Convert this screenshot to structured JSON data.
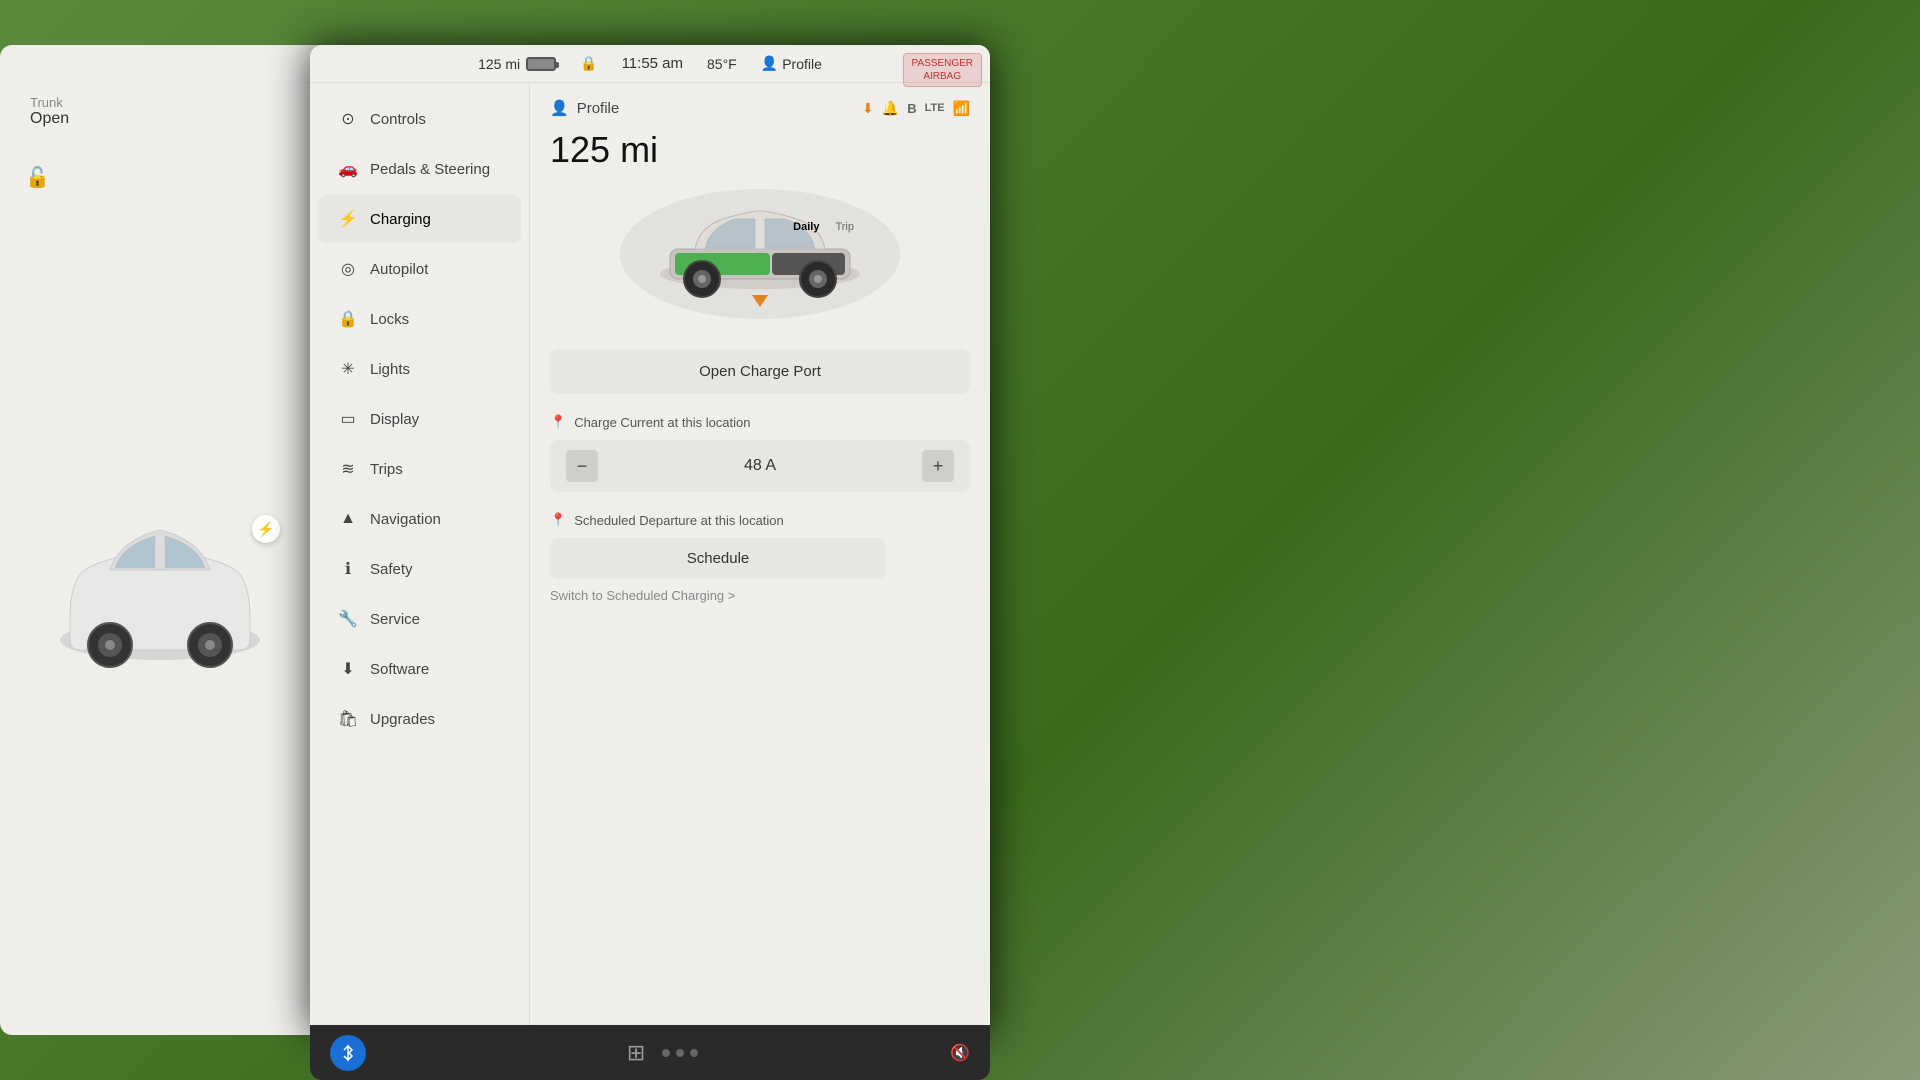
{
  "statusBar": {
    "battery": "125 mi",
    "time": "11:55 am",
    "temperature": "85°F",
    "profile": "Profile"
  },
  "sidebar": {
    "items": [
      {
        "id": "controls",
        "label": "Controls",
        "icon": "⊙"
      },
      {
        "id": "pedals",
        "label": "Pedals & Steering",
        "icon": "🚗"
      },
      {
        "id": "charging",
        "label": "Charging",
        "icon": "⚡",
        "active": true
      },
      {
        "id": "autopilot",
        "label": "Autopilot",
        "icon": "◎"
      },
      {
        "id": "locks",
        "label": "Locks",
        "icon": "🔒"
      },
      {
        "id": "lights",
        "label": "Lights",
        "icon": "✳"
      },
      {
        "id": "display",
        "label": "Display",
        "icon": "▭"
      },
      {
        "id": "trips",
        "label": "Trips",
        "icon": "≋"
      },
      {
        "id": "navigation",
        "label": "Navigation",
        "icon": "▲"
      },
      {
        "id": "safety",
        "label": "Safety",
        "icon": "ℹ"
      },
      {
        "id": "service",
        "label": "Service",
        "icon": "🔧"
      },
      {
        "id": "software",
        "label": "Software",
        "icon": "⬇"
      },
      {
        "id": "upgrades",
        "label": "Upgrades",
        "icon": "🛍"
      }
    ]
  },
  "chargingPanel": {
    "profileLabel": "Profile",
    "batteryMiles": "125 mi",
    "batteryTabs": [
      "Daily",
      "Trip"
    ],
    "openChargePortLabel": "Open Charge Port",
    "chargeCurrentLabel": "Charge Current at this location",
    "currentValue": "48 A",
    "decrementLabel": "−",
    "incrementLabel": "+",
    "scheduledDepartureLabel": "Scheduled Departure at this location",
    "scheduleLabel": "Schedule",
    "switchLink": "Switch to Scheduled Charging >"
  },
  "trunk": {
    "label": "Trunk",
    "status": "Open"
  },
  "taskbar": {
    "bluetoothIcon": "𝔅",
    "gridIcon": "▦",
    "muteIcon": "🔇"
  },
  "airbagBadge": {
    "line1": "PASSENGER",
    "line2": "AIRBAG"
  },
  "statusIcons": {
    "download": "⬇",
    "bell": "🔔",
    "bluetooth": "𝔅",
    "lte": "LTE",
    "signal": "📶"
  }
}
